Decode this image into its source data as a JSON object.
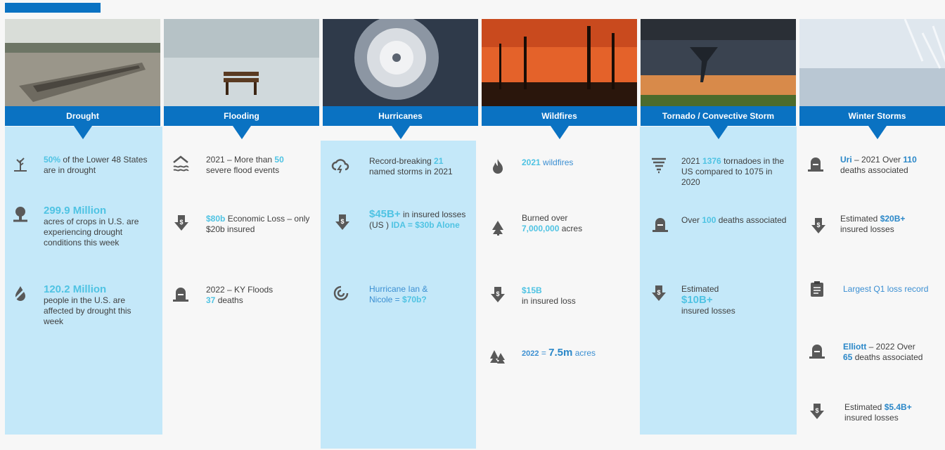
{
  "colors": {
    "accent": "#0a72c2",
    "panel": "#c4e8f9",
    "highlight": "#4fc3e3",
    "link": "#3b8fd2"
  },
  "columns": [
    {
      "title": "Drought",
      "items": [
        {
          "icon": "dead-tree-icon",
          "parts": [
            "50%",
            " of the Lower 48 States are in drought"
          ]
        },
        {
          "icon": "crops-icon",
          "parts": [
            "299.9 Million",
            "acres of crops in U.S. are experiencing drought conditions this week"
          ]
        },
        {
          "icon": "no-water-icon",
          "parts": [
            "120.2 Million",
            "people in the U.S. are affected by drought this week"
          ]
        }
      ]
    },
    {
      "title": "Flooding",
      "items": [
        {
          "icon": "flooded-house-icon",
          "parts": [
            "2021 – More than ",
            "50",
            " severe flood events"
          ]
        },
        {
          "icon": "money-down-icon",
          "parts": [
            "$80b",
            " Economic Loss – only $20b insured"
          ]
        },
        {
          "icon": "tombstone-icon",
          "parts": [
            "2022 – KY Floods ",
            "37",
            " deaths"
          ]
        }
      ]
    },
    {
      "title": "Hurricanes",
      "items": [
        {
          "icon": "storm-cloud-icon",
          "parts": [
            "Record-breaking ",
            "21",
            " named storms in 2021"
          ]
        },
        {
          "icon": "money-down-icon",
          "parts": [
            "$45B+",
            " in insured losses (US ) ",
            "IDA = $30b Alone"
          ]
        },
        {
          "icon": "hurricane-icon",
          "parts": [
            "Hurricane Ian & Nicole = ",
            "$70b?"
          ]
        }
      ]
    },
    {
      "title": "Wildfires",
      "items": [
        {
          "icon": "fire-icon",
          "parts": [
            "2021",
            " wildfires"
          ]
        },
        {
          "icon": "burning-tree-icon",
          "parts": [
            "Burned over ",
            "7,000,000",
            " acres"
          ]
        },
        {
          "icon": "money-down-icon",
          "parts": [
            "$15B",
            "in insured loss"
          ]
        },
        {
          "icon": "forest-fire-icon",
          "parts": [
            "2022",
            " = ",
            "7.5m",
            " acres"
          ]
        }
      ]
    },
    {
      "title": "Tornado / Convective Storm",
      "items": [
        {
          "icon": "tornado-icon",
          "parts": [
            "2021 ",
            "1376",
            " tornadoes in the US compared to 1075 in 2020"
          ]
        },
        {
          "icon": "tombstone-icon",
          "parts": [
            "Over ",
            "100",
            " deaths associated"
          ]
        },
        {
          "icon": "money-down-icon",
          "parts": [
            "Estimated",
            "$10B+",
            "insured losses"
          ]
        }
      ]
    },
    {
      "title": "Winter Storms",
      "items": [
        {
          "icon": "tombstone-icon",
          "parts": [
            "Uri",
            " – 2021 Over ",
            "110",
            " deaths associated"
          ]
        },
        {
          "icon": "money-down-icon",
          "parts": [
            "Estimated ",
            "$20B+",
            " insured losses"
          ]
        },
        {
          "icon": "clipboard-icon",
          "parts": [
            "Largest Q1 loss record"
          ]
        },
        {
          "icon": "tombstone-icon",
          "parts": [
            "Elliott",
            " – 2022 Over ",
            "65",
            " deaths associated"
          ]
        },
        {
          "icon": "money-down-icon",
          "parts": [
            "Estimated ",
            "$5.4B+",
            " insured losses"
          ]
        }
      ]
    }
  ]
}
